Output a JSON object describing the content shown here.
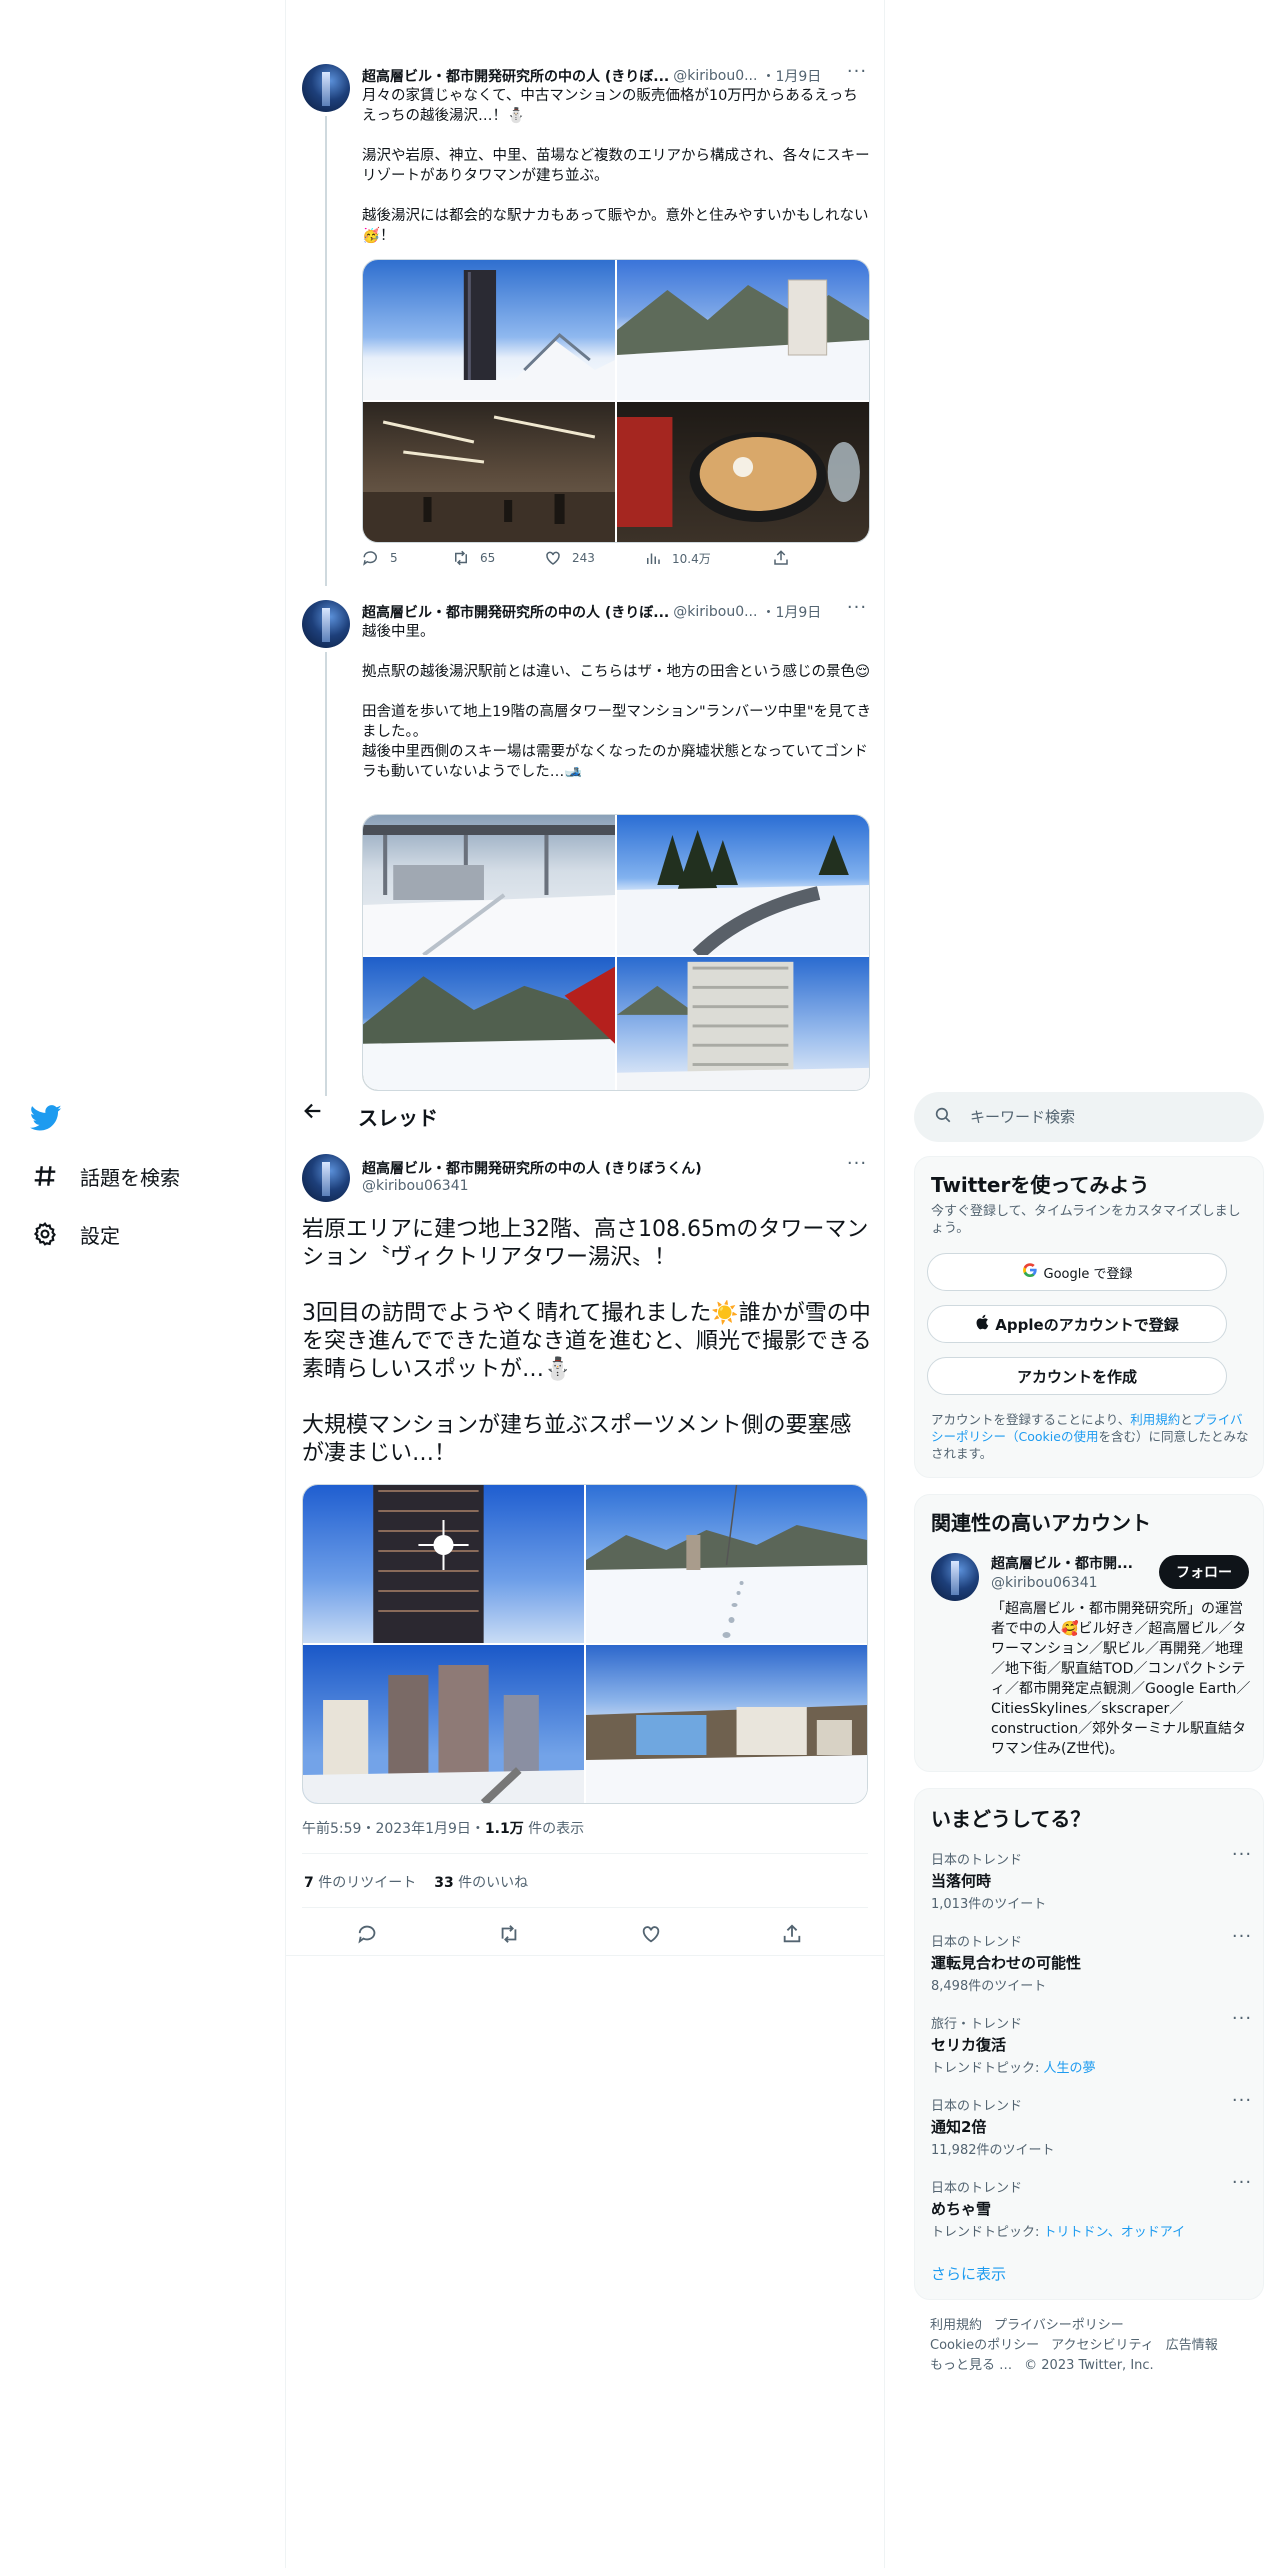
{
  "nav": {
    "explore_label": "話題を検索",
    "settings_label": "設定"
  },
  "header": {
    "title": "スレッド"
  },
  "thread": [
    {
      "name": "超高層ビル・都市開発研究所の中の人 (きりぼ...",
      "handle": "@kiribou0...",
      "date": "・1月9日",
      "text": "月々の家賃じゃなくて、中古マンションの販売価格が10万円からあるえっちえっちの越後湯沢…！⛄\n\n湯沢や岩原、神立、中里、苗場など複数のエリアから構成され、各々にスキーリゾートがありタワマンが建ち並ぶ。\n\n越後湯沢には都会的な駅ナカもあって賑やか。意外と住みやすいかもしれない🥳！",
      "replies": "5",
      "retweets": "65",
      "likes": "243",
      "views": "10.4万"
    },
    {
      "name": "超高層ビル・都市開発研究所の中の人 (きりぼ...",
      "handle": "@kiribou0...",
      "date": "・1月9日",
      "text": "越後中里。\n\n拠点駅の越後湯沢駅前とは違い、こちらはザ・地方の田舎という感じの景色😌\n\n田舎道を歩いて地上19階の高層タワー型マンション\"ランバーツ中里\"を見てきました。。\n越後中里西側のスキー場は需要がなくなったのか廃墟状態となっていてゴンドラも動いていないようでした…🎿"
    }
  ],
  "main_tweet": {
    "name": "超高層ビル・都市開発研究所の中の人 (きりぼうくん)",
    "handle": "@kiribou06341",
    "text": "岩原エリアに建つ地上32階、高さ108.65mのタワーマンション〝ヴィクトリアタワー湯沢〟！\n\n3回目の訪問でようやく晴れて撮れました☀️誰かが雪の中を突き進んでできた道なき道を進むと、順光で撮影できる素晴らしいスポットが…⛄\n\n大規模マンションが建ち並ぶスポーツメント側の要塞感が凄まじい…！",
    "time": "午前5:59・2023年1月9日・",
    "views_num": "1.1万",
    "views_label": "件の表示",
    "retweets_num": "7",
    "retweets_label": "件のリツイート",
    "likes_num": "33",
    "likes_label": "件のいいね"
  },
  "search": {
    "placeholder": "キーワード検索"
  },
  "signup": {
    "title": "Twitterを使ってみよう",
    "subtitle": "今すぐ登録して、タイムラインをカスタマイズしましょう。",
    "google": "Google で登録",
    "apple": "Appleのアカウントで登録",
    "create": "アカウントを作成",
    "legal_1": "アカウントを登録することにより、",
    "legal_terms": "利用規約",
    "legal_2": "と",
    "legal_privacy": "プライバシーポリシー",
    "legal_3": "（",
    "legal_cookie": "Cookieの使用",
    "legal_4": "を含む）に同意したとみなされます。"
  },
  "related": {
    "title": "関連性の高いアカウント",
    "name": "超高層ビル・都市開...",
    "handle": "@kiribou06341",
    "follow": "フォロー",
    "bio": "「超高層ビル・都市開発研究所」の運営者で中の人🥰ビル好き／超高層ビル／タワーマンション／駅ビル／再開発／地理／地下街／駅直結TOD／コンパクトシティ／都市開発定点観測／Google Earth／CitiesSkylines／skscraper／construction／郊外ターミナル駅直結タワマン住み(Z世代)。"
  },
  "trends": {
    "title": "いまどうしてる？",
    "items": [
      {
        "cat": "日本のトレンド",
        "name": "当落何時",
        "count": "1,013件のツイート"
      },
      {
        "cat": "日本のトレンド",
        "name": "運転見合わせの可能性",
        "count": "8,498件のツイート"
      },
      {
        "cat": "旅行・トレンド",
        "name": "セリカ復活",
        "count_prefix": "トレンドトピック: ",
        "count_link": "人生の夢"
      },
      {
        "cat": "日本のトレンド",
        "name": "通知2倍",
        "count": "11,982件のツイート"
      },
      {
        "cat": "日本のトレンド",
        "name": "めちゃ雪",
        "count_prefix": "トレンドトピック: ",
        "count_link": "トリトドン、オッドアイ"
      }
    ],
    "show_more": "さらに表示"
  },
  "footer": {
    "terms": "利用規約",
    "privacy": "プライバシーポリシー",
    "cookie": "Cookieのポリシー",
    "accessibility": "アクセシビリティ",
    "ads": "広告情報",
    "more": "もっと見る …",
    "copyright": "© 2023 Twitter, Inc."
  },
  "colors": {
    "accent": "#1d9bf0",
    "text": "#0f1419",
    "muted": "#536471"
  }
}
